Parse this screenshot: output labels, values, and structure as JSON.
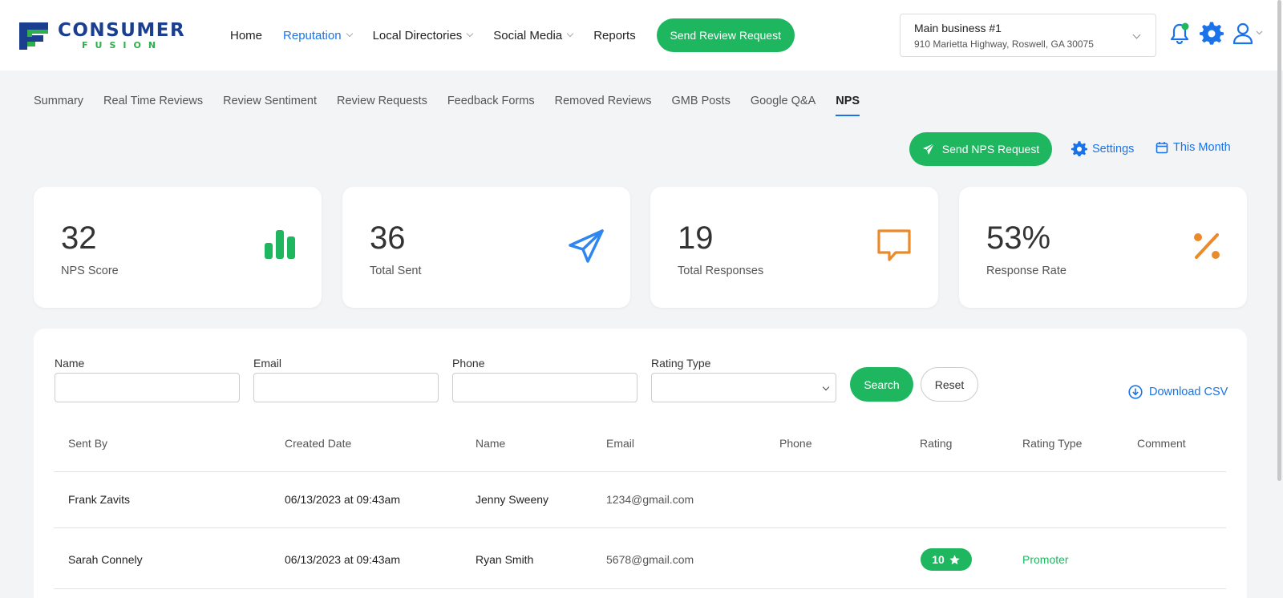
{
  "logo": {
    "line1": "CONSUMER",
    "line2": "FUSION"
  },
  "nav": {
    "items": [
      {
        "label": "Home"
      },
      {
        "label": "Reputation"
      },
      {
        "label": "Local Directories"
      },
      {
        "label": "Social Media"
      },
      {
        "label": "Reports"
      }
    ],
    "cta_label": "Send Review Request"
  },
  "business": {
    "name": "Main business #1",
    "address": "910 Marietta Highway, Roswell, GA 30075"
  },
  "tabs": [
    "Summary",
    "Real Time Reviews",
    "Review Sentiment",
    "Review Requests",
    "Feedback Forms",
    "Removed Reviews",
    "GMB Posts",
    "Google Q&A",
    "NPS"
  ],
  "actions": {
    "send_nps": "Send NPS Request",
    "settings": "Settings",
    "period": "This Month"
  },
  "stats": [
    {
      "value": "32",
      "label": "NPS Score"
    },
    {
      "value": "36",
      "label": "Total Sent"
    },
    {
      "value": "19",
      "label": "Total Responses"
    },
    {
      "value": "53%",
      "label": "Response Rate"
    }
  ],
  "filters": {
    "name_label": "Name",
    "email_label": "Email",
    "phone_label": "Phone",
    "rating_type_label": "Rating Type",
    "search_label": "Search",
    "reset_label": "Reset",
    "download_label": "Download CSV"
  },
  "table": {
    "columns": [
      "Sent By",
      "Created Date",
      "Name",
      "Email",
      "Phone",
      "Rating",
      "Rating Type",
      "Comment"
    ],
    "rows": [
      {
        "sent_by": "Frank Zavits",
        "created": "06/13/2023 at 09:43am",
        "name": "Jenny Sweeny",
        "email": "1234@gmail.com",
        "phone": "",
        "rating": "",
        "rating_type": "",
        "comment": ""
      },
      {
        "sent_by": "Sarah Connely",
        "created": "06/13/2023 at 09:43am",
        "name": "Ryan Smith",
        "email": "5678@gmail.com",
        "phone": "",
        "rating": "10",
        "rating_type": "Promoter",
        "comment": ""
      }
    ]
  },
  "colors": {
    "green": "#1fb660",
    "blue": "#1a73e8",
    "orange": "#ea8a2a",
    "navy": "#1b3e8f"
  }
}
